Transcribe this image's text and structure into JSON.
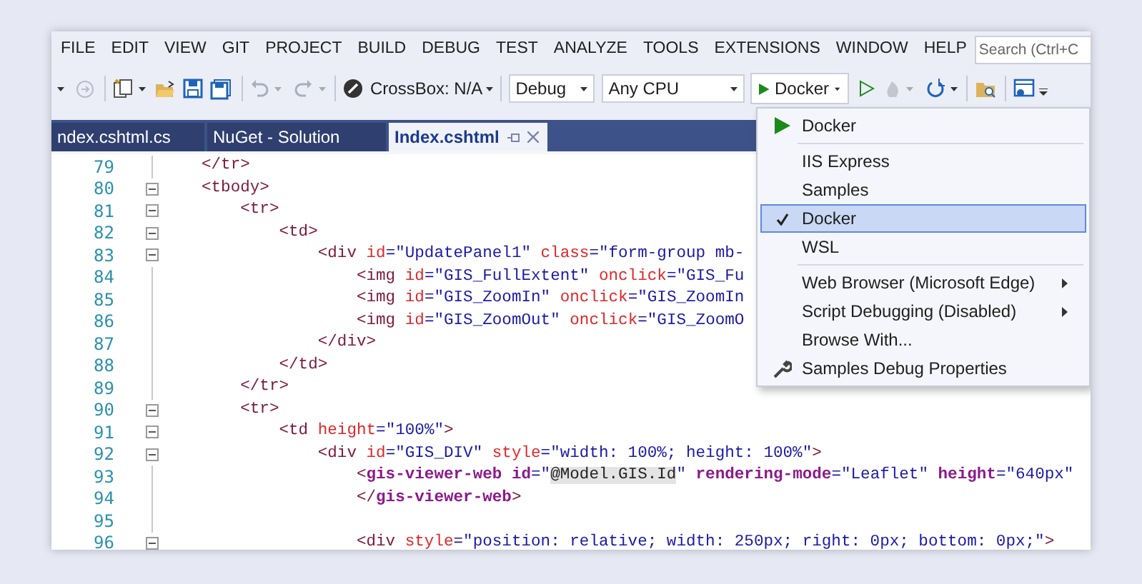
{
  "menu_bar": [
    "FILE",
    "EDIT",
    "VIEW",
    "GIT",
    "PROJECT",
    "BUILD",
    "DEBUG",
    "TEST",
    "ANALYZE",
    "TOOLS",
    "EXTENSIONS",
    "WINDOW",
    "HELP"
  ],
  "search": {
    "placeholder": "Search (Ctrl+C"
  },
  "toolbar": {
    "crossbox": "CrossBox: N/A",
    "configuration": "Debug",
    "platform": "Any CPU",
    "launch": "Docker"
  },
  "tabs": [
    {
      "label": "ndex.cshtml.cs",
      "selected": false
    },
    {
      "label": "NuGet - Solution",
      "selected": false
    },
    {
      "label": "Index.cshtml",
      "selected": true
    }
  ],
  "code_lines": [
    {
      "number": "79",
      "foldable": false,
      "tokens": [
        {
          "kind": "tag",
          "text": "</tr>"
        }
      ]
    },
    {
      "number": "80",
      "foldable": true,
      "tokens": [
        {
          "kind": "tag",
          "text": "<tbody>"
        }
      ]
    },
    {
      "number": "81",
      "foldable": true,
      "tokens": [
        {
          "kind": "tag",
          "text": "    <tr>"
        }
      ]
    },
    {
      "number": "82",
      "foldable": true,
      "tokens": [
        {
          "kind": "tag",
          "text": "        <td>"
        }
      ]
    },
    {
      "number": "83",
      "foldable": true,
      "tokens": [
        {
          "kind": "tag",
          "text": "            <div "
        },
        {
          "kind": "attr",
          "text": "id"
        },
        {
          "kind": "value",
          "text": "=\"UpdatePanel1\" "
        },
        {
          "kind": "attr",
          "text": "class"
        },
        {
          "kind": "value",
          "text": "=\"form-group mb-"
        }
      ]
    },
    {
      "number": "84",
      "foldable": false,
      "tokens": [
        {
          "kind": "tag",
          "text": "                <img "
        },
        {
          "kind": "attr",
          "text": "id"
        },
        {
          "kind": "value",
          "text": "=\"GIS_FullExtent\" "
        },
        {
          "kind": "attr",
          "text": "onclick"
        },
        {
          "kind": "value",
          "text": "=\"GIS_Fu"
        }
      ]
    },
    {
      "number": "85",
      "foldable": false,
      "tokens": [
        {
          "kind": "tag",
          "text": "                <img "
        },
        {
          "kind": "attr",
          "text": "id"
        },
        {
          "kind": "value",
          "text": "=\"GIS_ZoomIn\" "
        },
        {
          "kind": "attr",
          "text": "onclick"
        },
        {
          "kind": "value",
          "text": "=\"GIS_ZoomIn"
        }
      ]
    },
    {
      "number": "86",
      "foldable": false,
      "tokens": [
        {
          "kind": "tag",
          "text": "                <img "
        },
        {
          "kind": "attr",
          "text": "id"
        },
        {
          "kind": "value",
          "text": "=\"GIS_ZoomOut\" "
        },
        {
          "kind": "attr",
          "text": "onclick"
        },
        {
          "kind": "value",
          "text": "=\"GIS_ZoomO"
        }
      ]
    },
    {
      "number": "87",
      "foldable": false,
      "tokens": [
        {
          "kind": "tag",
          "text": "            </div>"
        }
      ]
    },
    {
      "number": "88",
      "foldable": false,
      "tokens": [
        {
          "kind": "tag",
          "text": "        </td>"
        }
      ]
    },
    {
      "number": "89",
      "foldable": false,
      "tokens": [
        {
          "kind": "tag",
          "text": "    </tr>"
        }
      ]
    },
    {
      "number": "90",
      "foldable": true,
      "tokens": [
        {
          "kind": "tag",
          "text": "    <tr>"
        }
      ]
    },
    {
      "number": "91",
      "foldable": true,
      "tokens": [
        {
          "kind": "tag",
          "text": "        <td "
        },
        {
          "kind": "attr",
          "text": "height"
        },
        {
          "kind": "value",
          "text": "=\"100%\""
        },
        {
          "kind": "tag",
          "text": ">"
        }
      ]
    },
    {
      "number": "92",
      "foldable": true,
      "tokens": [
        {
          "kind": "tag",
          "text": "            <div "
        },
        {
          "kind": "attr",
          "text": "id"
        },
        {
          "kind": "value",
          "text": "=\"GIS_DIV\" "
        },
        {
          "kind": "attr",
          "text": "style"
        },
        {
          "kind": "value",
          "text": "=\"width: 100%; height: 100%\""
        },
        {
          "kind": "tag",
          "text": ">"
        }
      ]
    },
    {
      "number": "93",
      "foldable": false,
      "tokens": [
        {
          "kind": "tag",
          "text": "                <"
        },
        {
          "kind": "custom",
          "text": "gis-viewer-web "
        },
        {
          "kind": "custom",
          "text": "id"
        },
        {
          "kind": "value",
          "text": "=\""
        },
        {
          "kind": "razor",
          "text": "@Model.GIS.Id"
        },
        {
          "kind": "value",
          "text": "\" "
        },
        {
          "kind": "custom",
          "text": "rendering-mode"
        },
        {
          "kind": "value",
          "text": "=\"Leaflet\" "
        },
        {
          "kind": "custom",
          "text": "height"
        },
        {
          "kind": "value",
          "text": "=\"640px\""
        }
      ]
    },
    {
      "number": "94",
      "foldable": false,
      "tokens": [
        {
          "kind": "tag",
          "text": "                </"
        },
        {
          "kind": "custom",
          "text": "gis-viewer-web"
        },
        {
          "kind": "tag",
          "text": ">"
        }
      ]
    },
    {
      "number": "95",
      "foldable": false
    },
    {
      "number": "96",
      "foldable": true,
      "tokens": [
        {
          "kind": "tag",
          "text": "                <div "
        },
        {
          "kind": "attr",
          "text": "style"
        },
        {
          "kind": "value",
          "text": "=\"position: relative; width: 250px; right: 0px; bottom: 0px;\""
        },
        {
          "kind": "tag",
          "text": ">"
        }
      ]
    }
  ],
  "launch_menu": [
    {
      "kind": "item",
      "label": "Docker",
      "checked": false,
      "selected": false,
      "submenu": false
    },
    {
      "kind": "separator"
    },
    {
      "kind": "item",
      "label": "IIS Express",
      "checked": false,
      "selected": false,
      "submenu": false
    },
    {
      "kind": "item",
      "label": "Samples",
      "checked": false,
      "selected": false,
      "submenu": false
    },
    {
      "kind": "item",
      "label": "Docker",
      "checked": true,
      "selected": true,
      "submenu": false
    },
    {
      "kind": "item",
      "label": "WSL",
      "checked": false,
      "selected": false,
      "submenu": false
    },
    {
      "kind": "separator"
    },
    {
      "kind": "item",
      "label": "Web Browser (Microsoft Edge)",
      "checked": false,
      "selected": false,
      "submenu": true
    },
    {
      "kind": "item",
      "label": "Script Debugging (Disabled)",
      "checked": false,
      "selected": false,
      "submenu": true
    },
    {
      "kind": "item",
      "label": "Browse With...",
      "checked": false,
      "selected": false,
      "submenu": false
    },
    {
      "kind": "item",
      "label": "Samples Debug Properties",
      "checked": false,
      "selected": false,
      "submenu": false
    }
  ]
}
